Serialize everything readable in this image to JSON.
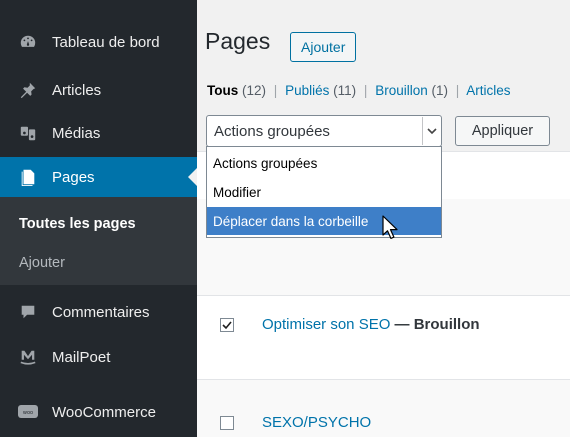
{
  "sidebar": {
    "items": [
      {
        "label": "Tableau de bord",
        "icon": "dashboard-icon"
      },
      {
        "label": "Articles",
        "icon": "pin-icon"
      },
      {
        "label": "Médias",
        "icon": "media-icon"
      },
      {
        "label": "Pages",
        "icon": "page-icon",
        "active": true
      },
      {
        "label": "Commentaires",
        "icon": "comment-icon"
      },
      {
        "label": "MailPoet",
        "icon": "mailpoet-icon"
      },
      {
        "label": "WooCommerce",
        "icon": "woo-icon"
      }
    ],
    "submenu": [
      {
        "label": "Toutes les pages",
        "current": true
      },
      {
        "label": "Ajouter",
        "current": false
      }
    ]
  },
  "header": {
    "title": "Pages",
    "add_button": "Ajouter"
  },
  "filters": {
    "all_label": "Tous",
    "all_count": "(12)",
    "published_label": "Publiés",
    "published_count": "(11)",
    "draft_label": "Brouillon",
    "draft_count": "(1)",
    "articles_label": "Articles",
    "separator": "|"
  },
  "bulk_actions": {
    "selected": "Actions groupées",
    "apply_button": "Appliquer",
    "options": [
      "Actions groupées",
      "Modifier",
      "Déplacer dans la corbeille"
    ],
    "highlighted_option": "Déplacer dans la corbeille"
  },
  "rows": [
    {
      "title": "Optimiser son SEO",
      "state": "— Brouillon",
      "checked": true
    },
    {
      "title": "SEXO/PSYCHO",
      "state": "",
      "checked": false
    }
  ],
  "colors": {
    "sidebar_bg": "#23282d",
    "submenu_bg": "#32373c",
    "active_bg": "#0073aa",
    "link": "#0073aa",
    "highlight": "#3e7fc8"
  }
}
